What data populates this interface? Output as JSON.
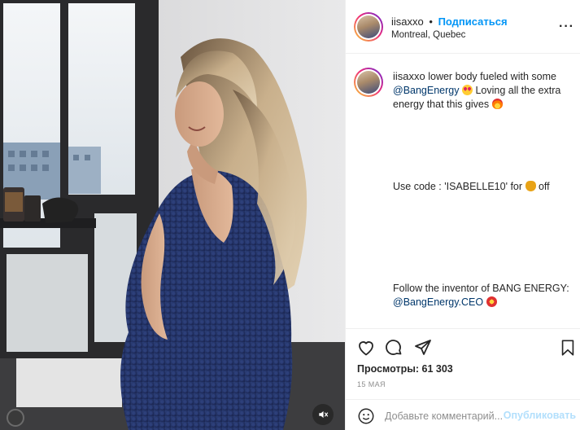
{
  "media": {
    "mute_icon": "volume-muted-icon"
  },
  "header": {
    "username": "iisaxxo",
    "separator": "•",
    "follow_label": "Подписаться",
    "location": "Montreal, Quebec",
    "more_icon": "more-options-icon",
    "more_label": "···"
  },
  "caption": {
    "username": "iisaxxo",
    "line1_text": " lower body fueled with some ",
    "mention1": "@BangEnergy",
    "line1_after": " Loving all the extra energy that this gives ",
    "line2_text": "Use code : 'ISABELLE10' for ",
    "line2_after": " off",
    "line3_text": "Follow the inventor of BANG ENERGY: ",
    "mention2": "@BangEnergy.CEO",
    "emojis": [
      "heart-eyes-emoji",
      "fire-emoji",
      "money-bag-emoji",
      "collision-emoji"
    ]
  },
  "actions": {
    "icons": [
      "heart-icon",
      "comment-icon",
      "share-icon",
      "bookmark-icon"
    ],
    "views_text": "Просмотры: 61 303",
    "date": "15 МАЯ"
  },
  "comment_box": {
    "placeholder": "Добавьте комментарий...",
    "publish_label": "Опубликовать"
  },
  "colors": {
    "accent": "#0095f6",
    "mention": "#00376b",
    "publish_disabled": "#b2dffc",
    "border": "#efefef"
  }
}
